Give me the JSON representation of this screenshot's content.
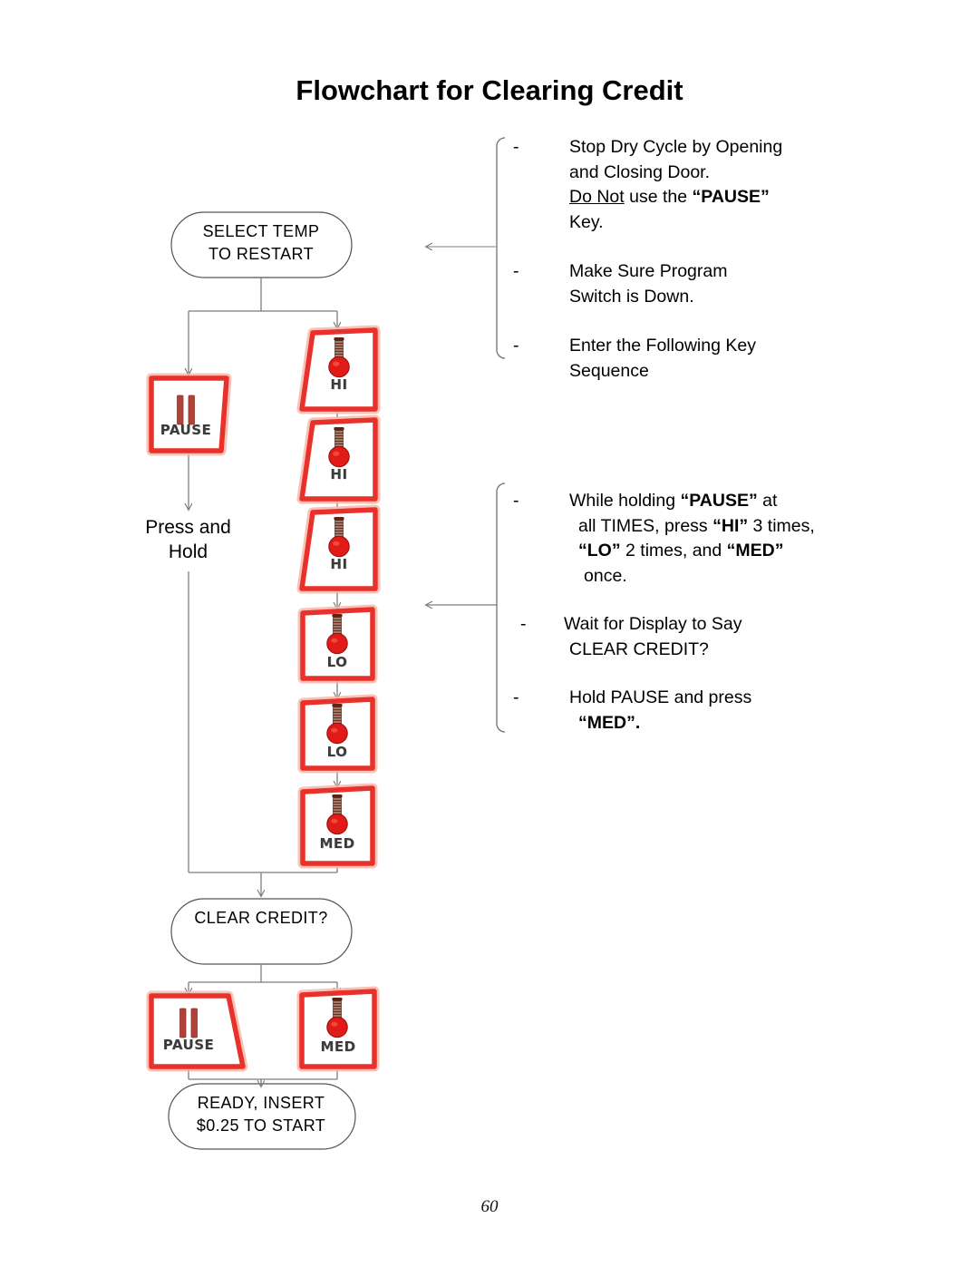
{
  "title": "Flowchart for Clearing Credit",
  "page_number": "60",
  "colors": {
    "key_border_red": "#e8312a",
    "key_glow_red": "#f6a192",
    "thermometer_bulb": "#e11b18",
    "thermometer_stem": "#6b2f1e",
    "connector_gray": "#808080",
    "shape_outline": "#555555"
  },
  "notes": {
    "block1": {
      "dash": "-",
      "items": [
        {
          "line1": "Stop Dry Cycle by Opening",
          "line2": "and Closing Door.",
          "line3_a": "Do Not",
          "line3_b": " use the ",
          "line3_c": "“PAUSE”",
          "line4": "Key."
        },
        {
          "line1": "Make Sure Program",
          "line2": "Switch is Down."
        },
        {
          "line1": "Enter the Following Key",
          "line2": "Sequence"
        }
      ]
    },
    "block2": {
      "dash": "-",
      "items": [
        {
          "line1_a": "While holding ",
          "line1_b": "“PAUSE”",
          "line1_c": " at",
          "line2_a": "all TIMES, press ",
          "line2_b": "“HI”",
          "line2_c": " 3 times,",
          "line3_a": "“LO”",
          "line3_b": " 2 times, and ",
          "line3_c": "“MED”",
          "line4": "once."
        },
        {
          "line1": "Wait for Display to Say",
          "line2": "CLEAR CREDIT?"
        },
        {
          "line1": "Hold PAUSE and press",
          "line2": "“MED”."
        }
      ]
    }
  },
  "flow": {
    "select_temp": {
      "line1": "SELECT TEMP",
      "line2": "TO RESTART"
    },
    "clear_credit": {
      "line1": "CLEAR CREDIT?"
    },
    "ready": {
      "line1": "READY, INSERT",
      "line2": "$0.25 TO START"
    },
    "press_hold": {
      "line1": "Press and",
      "line2": "Hold"
    },
    "keys": [
      {
        "id": "pause-1",
        "label": "PAUSE",
        "icon": "pause-bars",
        "shape": "trapezoid-right"
      },
      {
        "id": "hi-1",
        "label": "HI",
        "icon": "thermometer-red",
        "shape": "trapezoid-left"
      },
      {
        "id": "hi-2",
        "label": "HI",
        "icon": "thermometer-red",
        "shape": "trapezoid-left"
      },
      {
        "id": "hi-3",
        "label": "HI",
        "icon": "thermometer-red",
        "shape": "trapezoid-left"
      },
      {
        "id": "lo-1",
        "label": "LO",
        "icon": "thermometer-red",
        "shape": "rectangle"
      },
      {
        "id": "lo-2",
        "label": "LO",
        "icon": "thermometer-red",
        "shape": "rectangle"
      },
      {
        "id": "med-1",
        "label": "MED",
        "icon": "thermometer-red",
        "shape": "rectangle"
      },
      {
        "id": "pause-2",
        "label": "PAUSE",
        "icon": "pause-bars",
        "shape": "trapezoid-right"
      },
      {
        "id": "med-2",
        "label": "MED",
        "icon": "thermometer-red",
        "shape": "rectangle"
      }
    ]
  },
  "chart_data": {
    "type": "diagram",
    "title": "Flowchart for Clearing Credit",
    "nodes": [
      {
        "id": "select-temp",
        "kind": "display",
        "text": "SELECT TEMP TO RESTART"
      },
      {
        "id": "pause-1",
        "kind": "keypress",
        "text": "PAUSE"
      },
      {
        "id": "hi-1",
        "kind": "keypress",
        "text": "HI"
      },
      {
        "id": "hi-2",
        "kind": "keypress",
        "text": "HI"
      },
      {
        "id": "hi-3",
        "kind": "keypress",
        "text": "HI"
      },
      {
        "id": "lo-1",
        "kind": "keypress",
        "text": "LO"
      },
      {
        "id": "lo-2",
        "kind": "keypress",
        "text": "LO"
      },
      {
        "id": "med-1",
        "kind": "keypress",
        "text": "MED"
      },
      {
        "id": "clear-credit",
        "kind": "display",
        "text": "CLEAR CREDIT?"
      },
      {
        "id": "pause-2",
        "kind": "keypress",
        "text": "PAUSE"
      },
      {
        "id": "med-2",
        "kind": "keypress",
        "text": "MED"
      },
      {
        "id": "ready",
        "kind": "display",
        "text": "READY, INSERT $0.25 TO START"
      }
    ],
    "edges": [
      {
        "from": "select-temp",
        "to": "pause-1"
      },
      {
        "from": "select-temp",
        "to": "hi-1"
      },
      {
        "from": "hi-1",
        "to": "hi-2"
      },
      {
        "from": "hi-2",
        "to": "hi-3"
      },
      {
        "from": "hi-3",
        "to": "lo-1"
      },
      {
        "from": "lo-1",
        "to": "lo-2"
      },
      {
        "from": "lo-2",
        "to": "med-1"
      },
      {
        "from": "pause-1",
        "to": "clear-credit",
        "label": "Press and Hold"
      },
      {
        "from": "med-1",
        "to": "clear-credit"
      },
      {
        "from": "clear-credit",
        "to": "pause-2"
      },
      {
        "from": "clear-credit",
        "to": "med-2"
      },
      {
        "from": "pause-2",
        "to": "ready"
      },
      {
        "from": "med-2",
        "to": "ready"
      }
    ]
  }
}
